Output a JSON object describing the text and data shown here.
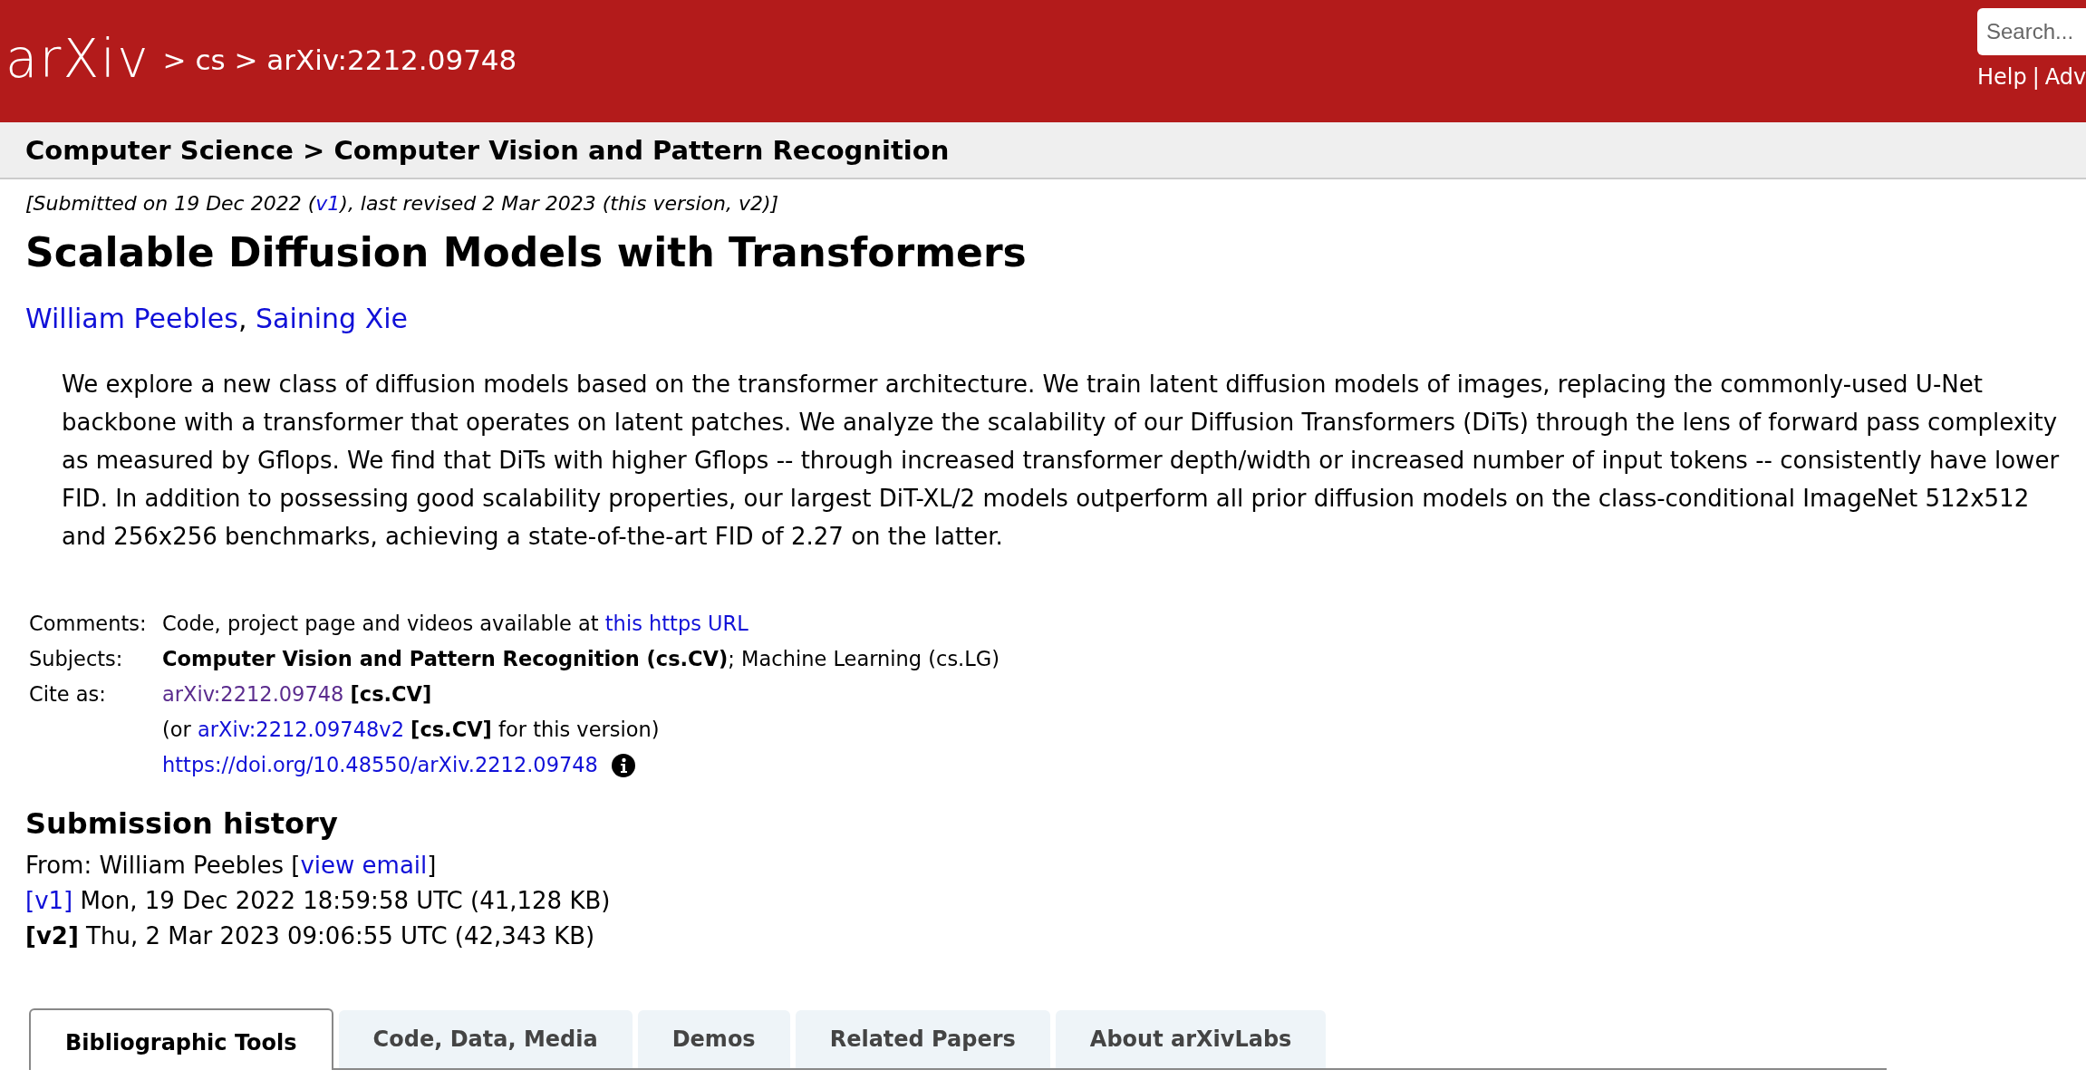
{
  "header": {
    "logo": "arXiv",
    "breadcrumb": "> cs > arXiv:2212.09748",
    "search": {
      "placeholder": "Search..."
    },
    "links": [
      {
        "text": "Help"
      },
      {
        "text": "Adv"
      }
    ],
    "link_separator": "|"
  },
  "subheader": "Computer Science > Computer Vision and Pattern Recognition",
  "dateline": [
    {
      "kind": "plain",
      "text": "[Submitted on 19 Dec 2022 ("
    },
    {
      "kind": "link",
      "text": "v1"
    },
    {
      "kind": "plain",
      "text": "), last revised 2 Mar 2023 (this version, v2)]"
    }
  ],
  "title": "Scalable Diffusion Models with Transformers",
  "authors": [
    {
      "kind": "link",
      "text": "William Peebles"
    },
    {
      "kind": "plain",
      "text": ", "
    },
    {
      "kind": "link",
      "text": "Saining Xie"
    }
  ],
  "abstract": "We explore a new class of diffusion models based on the transformer architecture. We train latent diffusion models of images, replacing the commonly-used U-Net backbone with a transformer that operates on latent patches. We analyze the scalability of our Diffusion Transformers (DiTs) through the lens of forward pass complexity as measured by Gflops. We find that DiTs with higher Gflops -- through increased transformer depth/width or increased number of input tokens -- consistently have lower FID. In addition to possessing good scalability properties, our largest DiT-XL/2 models outperform all prior diffusion models on the class-conditional ImageNet 512x512 and 256x256 benchmarks, achieving a state-of-the-art FID of 2.27 on the latter.",
  "metadata": [
    {
      "label": "Comments:",
      "lines": [
        {
          "segments": [
            {
              "kind": "plain",
              "text": "Code, project page and videos available at "
            },
            {
              "kind": "link",
              "text": "this https URL"
            }
          ]
        }
      ]
    },
    {
      "label": "Subjects:",
      "lines": [
        {
          "segments": [
            {
              "kind": "plain",
              "text": "**Computer Vision and Pattern Recognition (cs.CV)**; Machine Learning (cs.LG)"
            }
          ]
        }
      ]
    },
    {
      "label": "Cite as:",
      "lines": [
        {
          "segments": [
            {
              "kind": "visited",
              "text": "arXiv:2212.09748"
            },
            {
              "kind": "plain",
              "text": " **[cs.CV]**"
            }
          ]
        },
        {
          "segments": [
            {
              "kind": "plain",
              "text": "(or "
            },
            {
              "kind": "link",
              "text": "arXiv:2212.09748v2"
            },
            {
              "kind": "plain",
              "text": " **[cs.CV]** for this version)"
            }
          ]
        },
        {
          "info_icon": true,
          "segments": [
            {
              "kind": "link",
              "text": "https://doi.org/10.48550/arXiv.2212.09748"
            }
          ]
        }
      ]
    }
  ],
  "history": {
    "heading": "Submission history",
    "lines": [
      [
        {
          "kind": "plain",
          "text": "From: William Peebles ["
        },
        {
          "kind": "link",
          "text": "view email"
        },
        {
          "kind": "plain",
          "text": "]"
        }
      ],
      [
        {
          "kind": "link",
          "text": "[v1]"
        },
        {
          "kind": "plain",
          "text": " Mon, 19 Dec 2022 18:59:58 UTC (41,128 KB)"
        }
      ],
      [
        {
          "kind": "plain",
          "text": "**[v2]** Thu, 2 Mar 2023 09:06:55 UTC (42,343 KB)"
        }
      ]
    ]
  },
  "tabs": [
    {
      "label": "Bibliographic Tools",
      "selected": true
    },
    {
      "label": "Code, Data, Media",
      "selected": false
    },
    {
      "label": "Demos",
      "selected": false
    },
    {
      "label": "Related Papers",
      "selected": false
    },
    {
      "label": "About arXivLabs",
      "selected": false
    }
  ]
}
